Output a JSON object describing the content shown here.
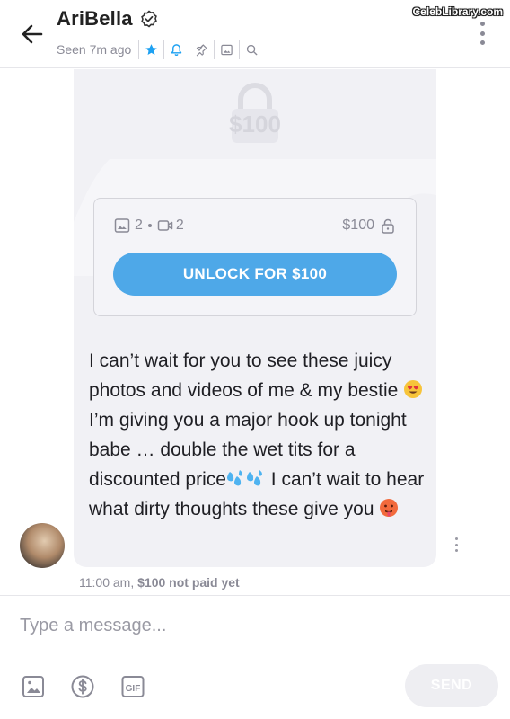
{
  "header": {
    "name": "AriBella",
    "seen": "Seen 7m ago",
    "watermark": "CelebLibrary.com",
    "icons": [
      "star-icon",
      "bell-icon",
      "pin-icon",
      "image-icon",
      "search-icon"
    ],
    "accent": "#1da1f2"
  },
  "message": {
    "locked_price": "$100",
    "photos_count": "2",
    "videos_count": "2",
    "price": "$100",
    "unlock_label": "UNLOCK FOR $100",
    "text_parts": [
      "I can’t wait for you to see these juicy photos and videos of me & my bestie ",
      " I’m giving you a major hook up tonight babe … double the wet tits for a discounted price",
      " I can’t wait to hear what dirty thoughts these give you "
    ],
    "time": "11:00 am,",
    "status": "$100 not paid yet"
  },
  "composer": {
    "placeholder": "Type a message...",
    "send_label": "SEND",
    "gif_label": "GIF"
  },
  "colors": {
    "unlock_button": "#4ea8e8",
    "card_bg": "#f1f1f5",
    "muted_text": "#8a8a96"
  }
}
